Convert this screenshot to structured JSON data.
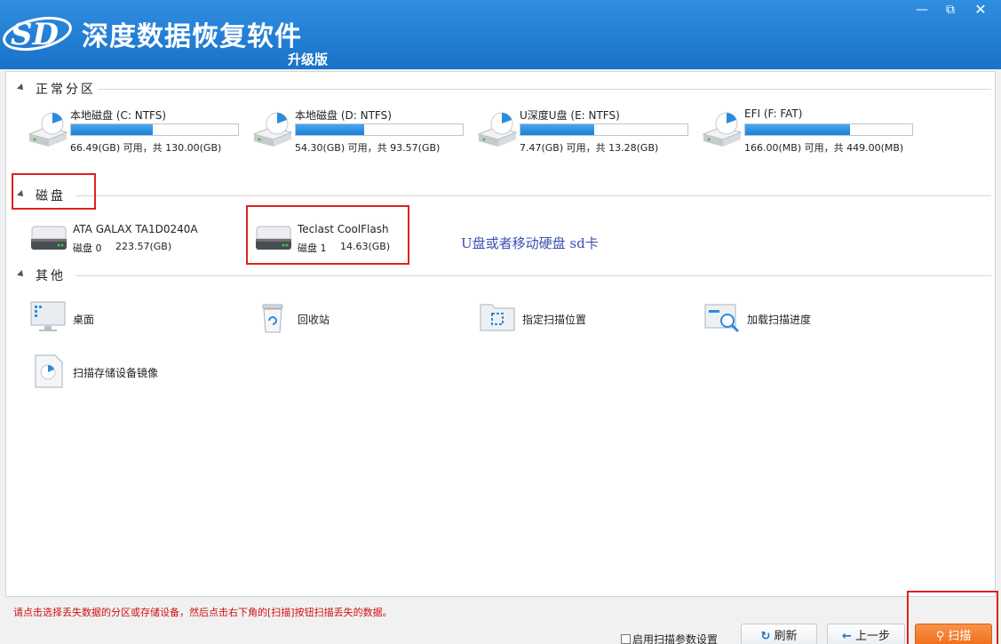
{
  "app": {
    "title": "深度数据恢复软件",
    "subtitle": "升级版",
    "logo_text": "SD"
  },
  "window_controls": {
    "minimize": "—",
    "restore": "⧉",
    "close": "✕"
  },
  "sections": {
    "normal": {
      "label": "正常分区",
      "partitions": [
        {
          "name": "本地磁盘 (C: NTFS)",
          "detail": "66.49(GB) 可用，共 130.00(GB)",
          "used_fraction": 0.49
        },
        {
          "name": "本地磁盘 (D: NTFS)",
          "detail": "54.30(GB) 可用，共 93.57(GB)",
          "used_fraction": 0.41
        },
        {
          "name": "U深度U盘 (E: NTFS)",
          "detail": "7.47(GB) 可用，共 13.28(GB)",
          "used_fraction": 0.44
        },
        {
          "name": "EFI (F: FAT)",
          "detail": "166.00(MB) 可用，共 449.00(MB)",
          "used_fraction": 0.63
        }
      ]
    },
    "disks": {
      "label": "磁盘",
      "items": [
        {
          "name": "ATA GALAX TA1D0240A",
          "index": "磁盘 0",
          "size": "223.57(GB)"
        },
        {
          "name": "Teclast CoolFlash",
          "index": "磁盘 1",
          "size": "14.63(GB)"
        }
      ],
      "annotation": "U盘或者移动硬盘 sd卡"
    },
    "other": {
      "label": "其他",
      "items": [
        {
          "label": "桌面",
          "icon": "desktop-icon"
        },
        {
          "label": "回收站",
          "icon": "recycle-bin-icon"
        },
        {
          "label": "指定扫描位置",
          "icon": "folder-scan-icon"
        },
        {
          "label": "加载扫描进度",
          "icon": "load-progress-icon"
        },
        {
          "label": "扫描存储设备镜像",
          "icon": "disk-image-icon"
        }
      ]
    }
  },
  "footer": {
    "hint": "请点击选择丢失数据的分区或存储设备，然后点击右下角的[扫描]按钮扫描丢失的数据。",
    "checkbox_label": "启用扫描参数设置",
    "refresh_label": "刷新",
    "back_label": "上一步",
    "scan_label": "扫描"
  },
  "colors": {
    "titlebar": "#1a72c9",
    "progress": "#2a8be0",
    "highlight_box": "#e02020",
    "annotation": "#3a4fb0",
    "scan_button": "#ef6b17"
  }
}
